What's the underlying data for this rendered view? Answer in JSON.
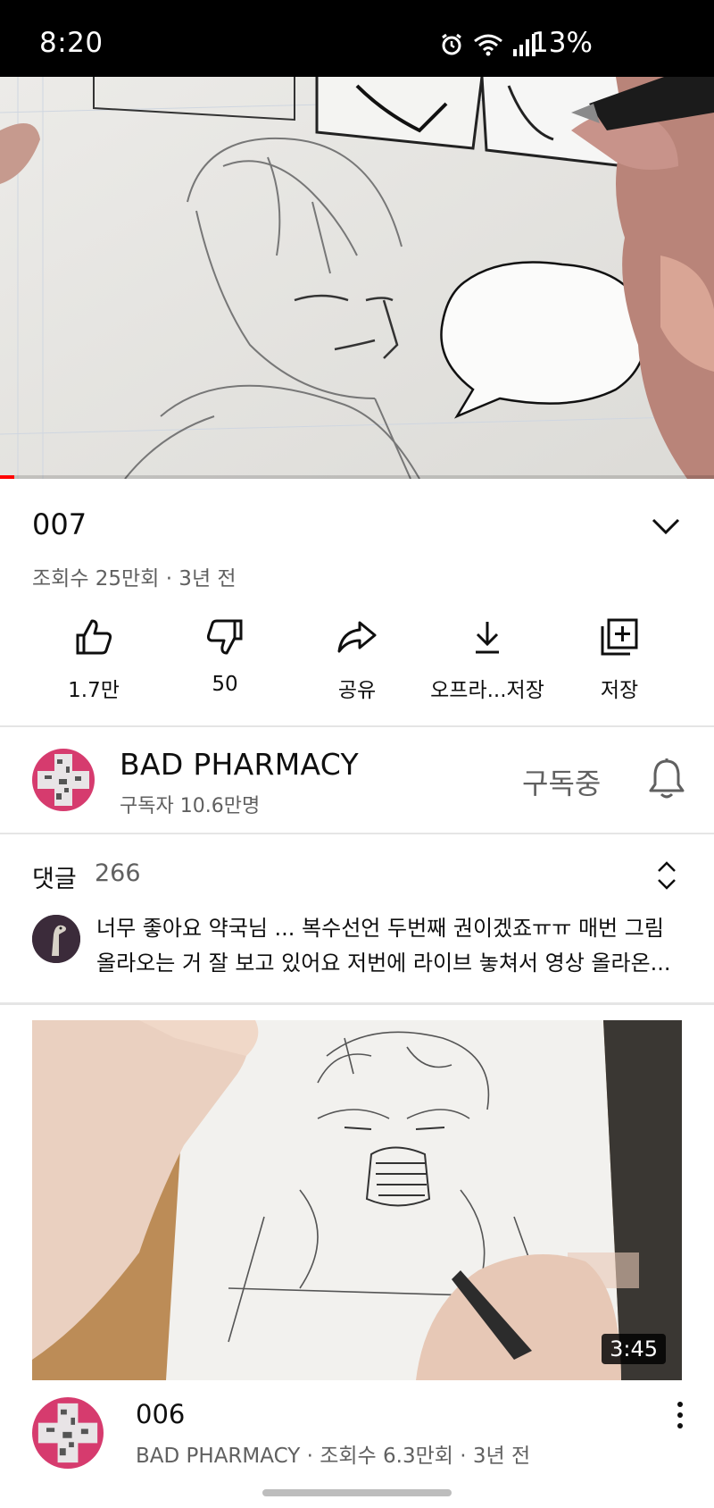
{
  "status_bar": {
    "time": "8:20",
    "battery": "13%"
  },
  "video": {
    "title": "007",
    "meta": "조회수 25만회 · 3년 전",
    "progress": 0.02
  },
  "actions": {
    "like": "1.7만",
    "dislike": "50",
    "share": "공유",
    "offline_save": "오프라...저장",
    "save": "저장"
  },
  "channel": {
    "name": "BAD PHARMACY",
    "subscribers": "구독자 10.6만명",
    "subscribed_label": "구독중"
  },
  "comments": {
    "label": "댓글",
    "count": "266",
    "top_comment": "너무 좋아요 약국님 ... 복수선언 두번째 권이겠죠ㅠㅠ 매번 그림 올라오는 거 잘 보고 있어요 저번에 라이브 놓쳐서 영상 올라온..."
  },
  "next_video": {
    "title": "006",
    "meta": "BAD PHARMACY · 조회수 6.3만회 · 3년 전",
    "duration": "3:45"
  },
  "colors": {
    "progress": "#ff0000",
    "secondary_text": "#606060",
    "avatar_brand": "#d63b6e"
  }
}
